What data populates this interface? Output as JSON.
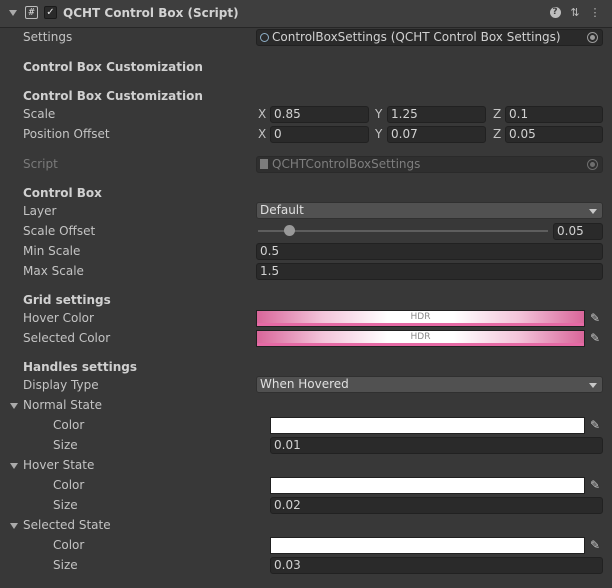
{
  "header": {
    "component_title": "QCHT Control Box (Script)",
    "script_glyph": "#",
    "check_glyph": "✓",
    "help_glyph": "?",
    "preset_glyph": "⇅",
    "menu_glyph": "⋮",
    "enabled": true
  },
  "settings": {
    "label": "Settings",
    "value": "ControlBoxSettings (QCHT Control Box Settings)"
  },
  "customization": {
    "heading_1": "Control Box Customization",
    "heading_2": "Control Box Customization",
    "scale": {
      "label": "Scale",
      "x_axis": "X",
      "y_axis": "Y",
      "z_axis": "Z",
      "x": "0.85",
      "y": "1.25",
      "z": "0.1"
    },
    "position_offset": {
      "label": "Position Offset",
      "x_axis": "X",
      "y_axis": "Y",
      "z_axis": "Z",
      "x": "0",
      "y": "0.07",
      "z": "0.05"
    }
  },
  "script_field": {
    "label": "Script",
    "value": "QCHTControlBoxSettings"
  },
  "control_box": {
    "heading": "Control Box",
    "layer": {
      "label": "Layer",
      "value": "Default"
    },
    "scale_offset": {
      "label": "Scale Offset",
      "value": "0.05",
      "slider_fraction": 0.1
    },
    "min_scale": {
      "label": "Min Scale",
      "value": "0.5"
    },
    "max_scale": {
      "label": "Max Scale",
      "value": "1.5"
    }
  },
  "grid": {
    "heading": "Grid settings",
    "hover_color": {
      "label": "Hover Color",
      "badge": "HDR",
      "color": "#e56aa5"
    },
    "selected_color": {
      "label": "Selected Color",
      "badge": "HDR",
      "color": "#e56aa5"
    }
  },
  "handles": {
    "heading": "Handles settings",
    "display_type": {
      "label": "Display Type",
      "value": "When Hovered"
    },
    "normal_state": {
      "label": "Normal State",
      "color_label": "Color",
      "size_label": "Size",
      "color": "#ffffff",
      "size": "0.01"
    },
    "hover_state": {
      "label": "Hover State",
      "color_label": "Color",
      "size_label": "Size",
      "color": "#ffffff",
      "size": "0.02"
    },
    "selected_state": {
      "label": "Selected State",
      "color_label": "Color",
      "size_label": "Size",
      "color": "#ffffff",
      "size": "0.03"
    }
  },
  "icons": {
    "eyedropper": "✎"
  }
}
